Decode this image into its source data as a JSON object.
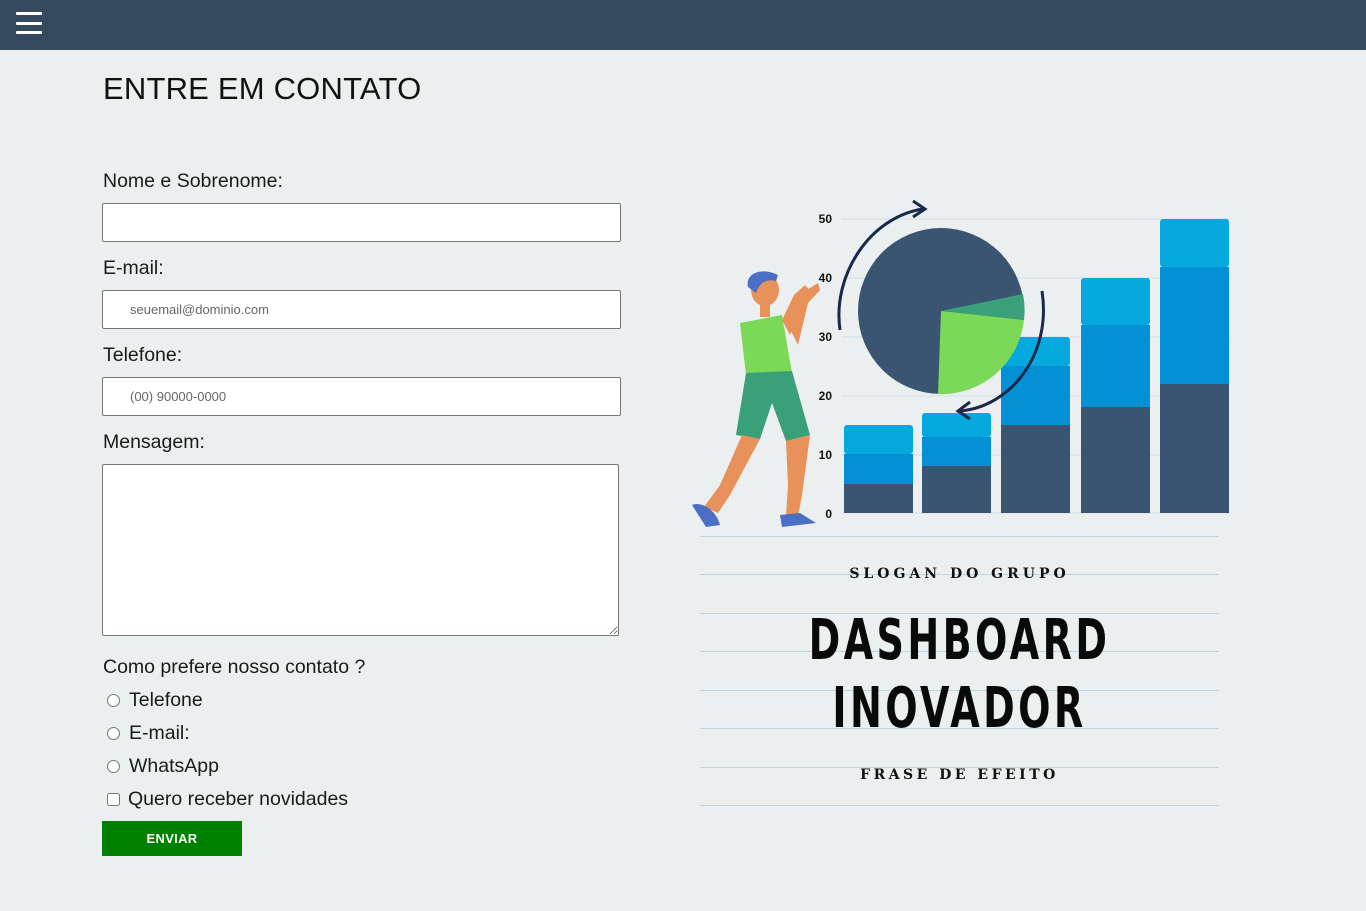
{
  "header": {
    "menu_icon": "hamburger-menu-icon",
    "bg_color": "#34495e"
  },
  "form": {
    "title": "ENTRE EM CONTATO",
    "name_label": "Nome e Sobrenome:",
    "name_value": "",
    "email_label": "E-mail:",
    "email_placeholder": "seuemail@dominio.com",
    "phone_label": "Telefone:",
    "phone_placeholder": "(00) 90000-0000",
    "message_label": "Mensagem:",
    "message_value": "",
    "contact_question": "Como prefere nosso contato ?",
    "contact_options": [
      "Telefone",
      "E-mail:",
      "WhatsApp"
    ],
    "newsletter_label": "Quero receber novidades",
    "submit_label": "ENVIAR",
    "submit_color": "#008000"
  },
  "illustration": {
    "y_ticks": [
      "50",
      "40",
      "30",
      "20",
      "10",
      "0"
    ],
    "colors": {
      "dark": "#3a5572",
      "mid": "#0390d5",
      "light": "#05a9dd",
      "green": "#7cd957",
      "teal": "#3aa07a"
    }
  },
  "poster": {
    "slogan": "SLOGAN DO GRUPO",
    "title_line1": "DASHBOARD",
    "title_line2": "INOVADOR",
    "tagline": "FRASE DE EFEITO"
  }
}
